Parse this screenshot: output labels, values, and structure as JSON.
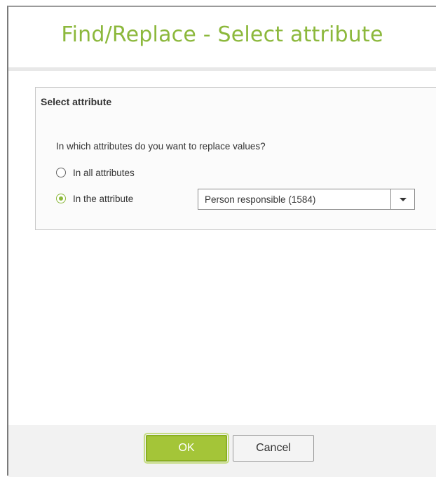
{
  "dialog": {
    "title": "Find/Replace - Select attribute"
  },
  "group": {
    "title": "Select attribute",
    "question": "In which attributes do you want to replace values?",
    "options": [
      {
        "label": "In all attributes",
        "checked": false
      },
      {
        "label": "In the attribute",
        "checked": true
      }
    ],
    "attribute_select": {
      "value": "Person responsible (1584)"
    }
  },
  "buttons": {
    "ok_label": "OK",
    "cancel_label": "Cancel"
  },
  "colors": {
    "accent": "#8cb83c",
    "ok_button": "#a4c538"
  },
  "icons": {
    "dropdown": "chevron-down-icon"
  }
}
